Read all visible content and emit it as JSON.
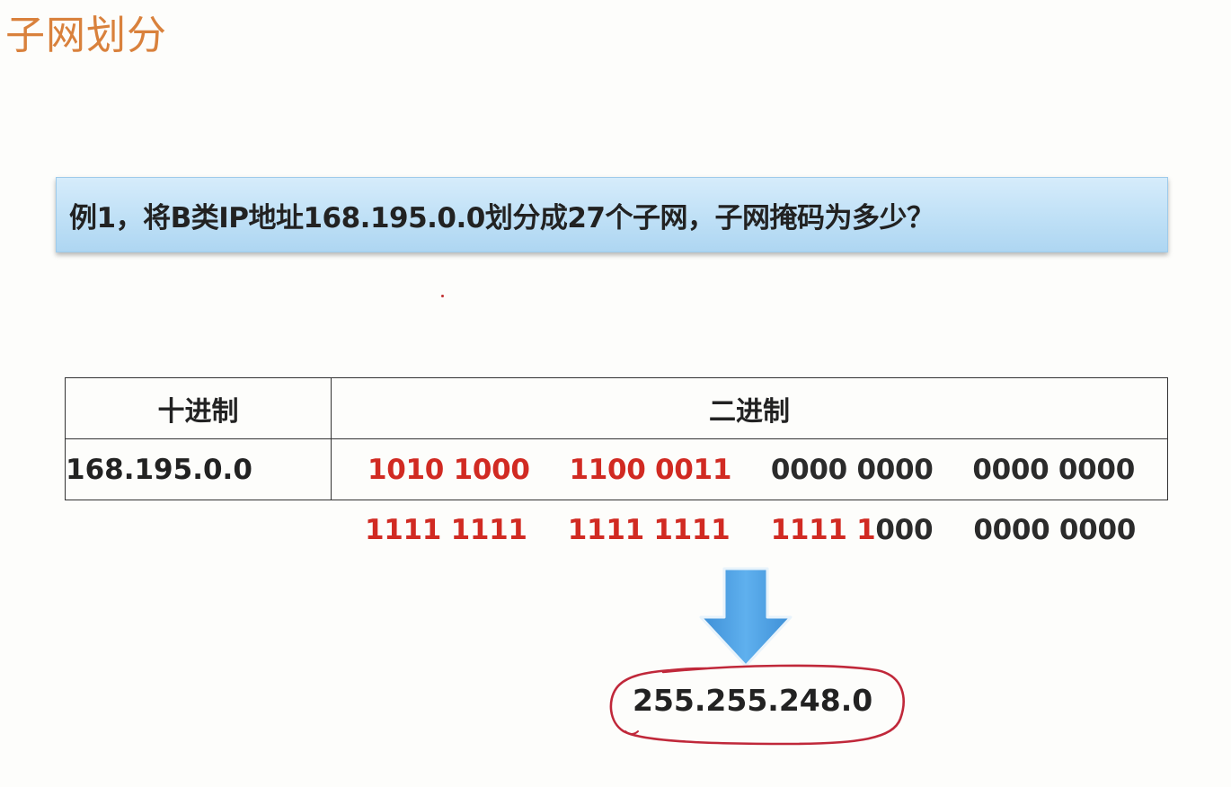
{
  "slide": {
    "title": "子网划分",
    "question": "例1，将B类IP地址168.195.0.0划分成27个子网，子网掩码为多少？"
  },
  "table": {
    "headers": [
      "十进制",
      "二进制"
    ],
    "row": {
      "decimal": "168.195.0.0",
      "binary_groups": [
        {
          "text": "1010 1000",
          "color": "red"
        },
        {
          "text": "1100 0011",
          "color": "red"
        },
        {
          "text": "0000 0000",
          "color": "dark"
        },
        {
          "text": "0000 0000",
          "color": "dark"
        }
      ]
    }
  },
  "mask_binary": {
    "groups": [
      {
        "text": "1111 1111",
        "color": "red"
      },
      {
        "text": "1111 1111",
        "color": "red"
      },
      {
        "red_part": "1111 1",
        "dark_part": "000"
      },
      {
        "text": "0000 0000",
        "color": "dark"
      }
    ]
  },
  "result": {
    "mask": "255.255.248.0"
  },
  "colors": {
    "title": "#d9813c",
    "highlight_red": "#d12a22",
    "banner_blue": "#bfe0f6",
    "arrow_blue": "#4a9ee0",
    "circle_red": "#c0283a"
  }
}
